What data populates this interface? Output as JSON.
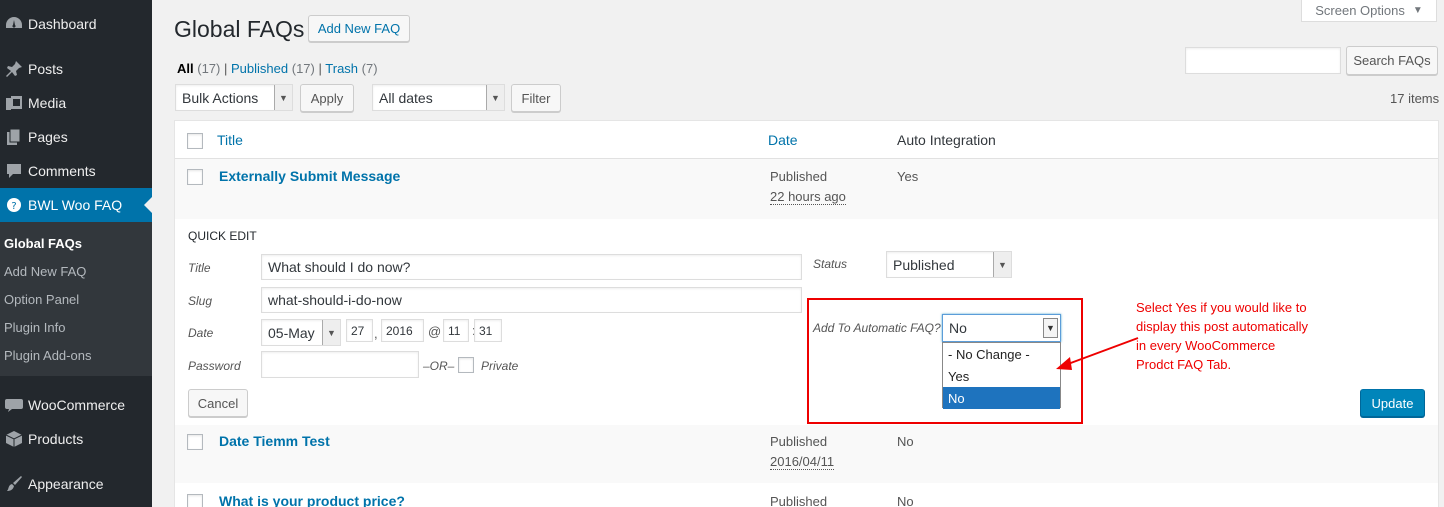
{
  "sidebar": {
    "items": [
      {
        "label": "Dashboard",
        "icon": "dashboard-icon"
      },
      {
        "label": "Posts",
        "icon": "pin-icon"
      },
      {
        "label": "Media",
        "icon": "media-icon"
      },
      {
        "label": "Pages",
        "icon": "pages-icon"
      },
      {
        "label": "Comments",
        "icon": "comment-icon"
      },
      {
        "label": "BWL Woo FAQ",
        "icon": "help-icon"
      },
      {
        "label": "WooCommerce",
        "icon": "woo-icon"
      },
      {
        "label": "Products",
        "icon": "box-icon"
      },
      {
        "label": "Appearance",
        "icon": "brush-icon"
      }
    ],
    "submenu": [
      "Global FAQs",
      "Add New FAQ",
      "Option Panel",
      "Plugin Info",
      "Plugin Add-ons"
    ]
  },
  "header": {
    "title": "Global FAQs",
    "add_new": "Add New FAQ",
    "screen_options": "Screen Options",
    "search_button": "Search FAQs"
  },
  "views": {
    "all": "All",
    "all_count": "(17)",
    "published": "Published",
    "published_count": "(17)",
    "trash": "Trash",
    "trash_count": "(7)",
    "sep": "|"
  },
  "toolbar": {
    "bulk_actions": "Bulk Actions",
    "apply": "Apply",
    "dates": "All dates",
    "filter": "Filter",
    "items_count": "17 items"
  },
  "table": {
    "columns": {
      "title": "Title",
      "date": "Date",
      "auto": "Auto Integration"
    },
    "rows": [
      {
        "title": "Externally Submit Message",
        "status": "Published",
        "date": "22 hours ago",
        "auto": "Yes"
      },
      {
        "title": "Date Tiemm Test",
        "status": "Published",
        "date": "2016/04/11",
        "auto": "No"
      },
      {
        "title": "What is your product price?",
        "status": "Published",
        "date": "",
        "auto": "No"
      }
    ]
  },
  "quick_edit": {
    "heading": "Quick Edit",
    "title_label": "Title",
    "title_value": "What should I do now?",
    "slug_label": "Slug",
    "slug_value": "what-should-i-do-now",
    "date_label": "Date",
    "month": "05-May",
    "day": "27",
    "comma": ",",
    "year": "2016",
    "at": "@",
    "hour": "11",
    "colon": ":",
    "minute": "31",
    "password_label": "Password",
    "or": "–OR–",
    "private": "Private",
    "status_label": "Status",
    "status_value": "Published",
    "auto_label": "Add To Automatic FAQ?",
    "auto_value": "No",
    "auto_options": [
      "- No Change -",
      "Yes",
      "No"
    ],
    "cancel": "Cancel",
    "update": "Update"
  },
  "annotation": "Select Yes if you would like to display this post automatically in every WooCommerce Prodct FAQ Tab.",
  "colors": {
    "accent": "#0073aa",
    "sidebar": "#23282d",
    "highlight": "#ee0000",
    "primary_button": "#0085ba"
  }
}
